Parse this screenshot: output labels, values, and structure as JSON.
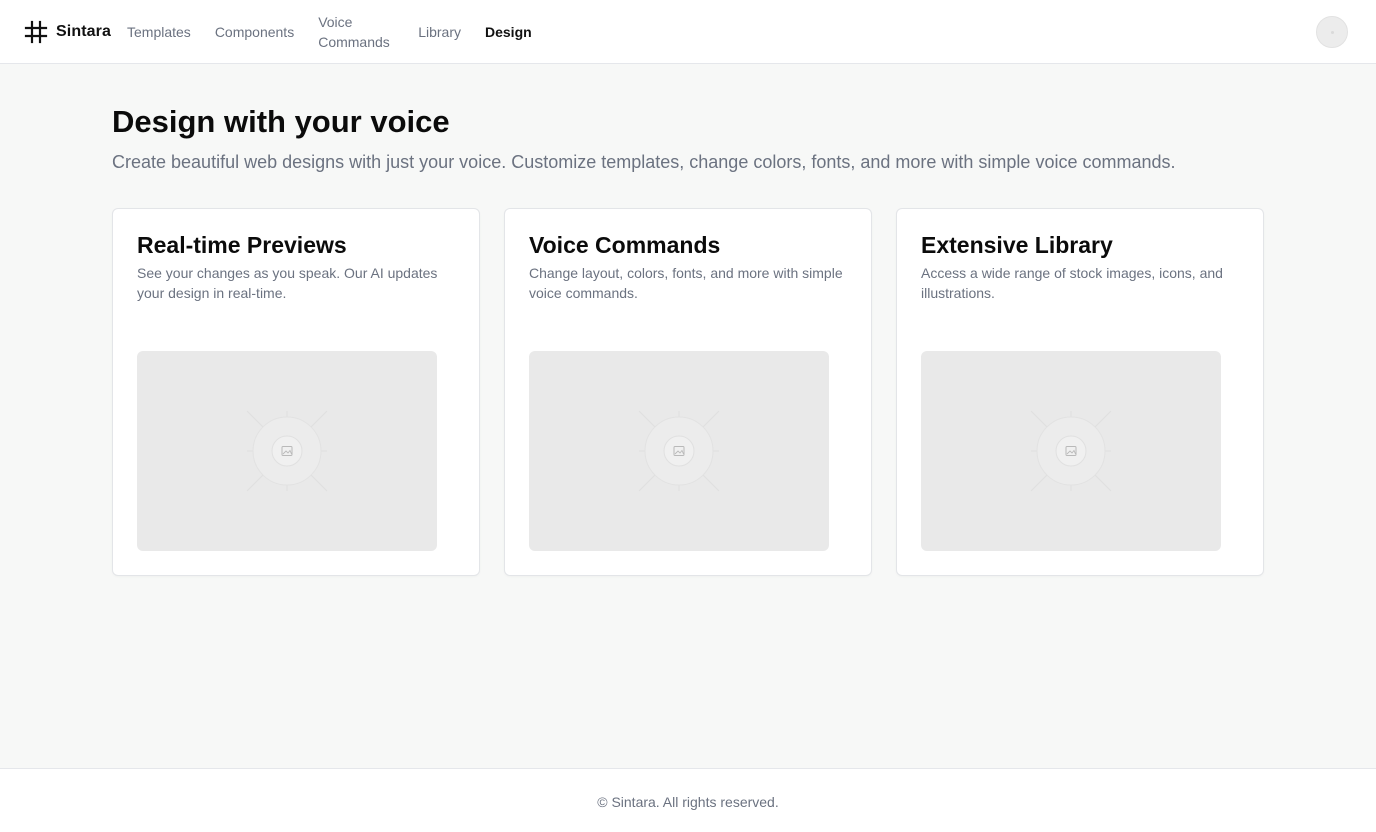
{
  "header": {
    "brand_name": "Sintara",
    "brand_icon": "hash-grid-icon",
    "nav": [
      {
        "label": "Templates",
        "active": false
      },
      {
        "label": "Components",
        "active": false
      },
      {
        "label": "Voice Commands",
        "active": false
      },
      {
        "label": "Library",
        "active": false
      },
      {
        "label": "Design",
        "active": true
      }
    ],
    "avatar_icon": "user-avatar-icon"
  },
  "main": {
    "title": "Design with your voice",
    "subtitle": "Create beautiful web designs with just your voice. Customize templates, change colors, fonts, and more with simple voice commands.",
    "cards": [
      {
        "title": "Real-time Previews",
        "description": "See your changes as you speak. Our AI updates your design in real-time.",
        "image_icon": "image-placeholder-icon"
      },
      {
        "title": "Voice Commands",
        "description": "Change layout, colors, fonts, and more with simple voice commands.",
        "image_icon": "image-placeholder-icon"
      },
      {
        "title": "Extensive Library",
        "description": "Access a wide range of stock images, icons, and illustrations.",
        "image_icon": "image-placeholder-icon"
      }
    ]
  },
  "footer": {
    "text": "© Sintara. All rights reserved."
  },
  "colors": {
    "page_background": "#f7f8f7",
    "surface": "#ffffff",
    "border": "#e5e7eb",
    "text_primary": "#0b0b0b",
    "text_muted": "#6b7280",
    "placeholder": "#e9e9e9"
  }
}
